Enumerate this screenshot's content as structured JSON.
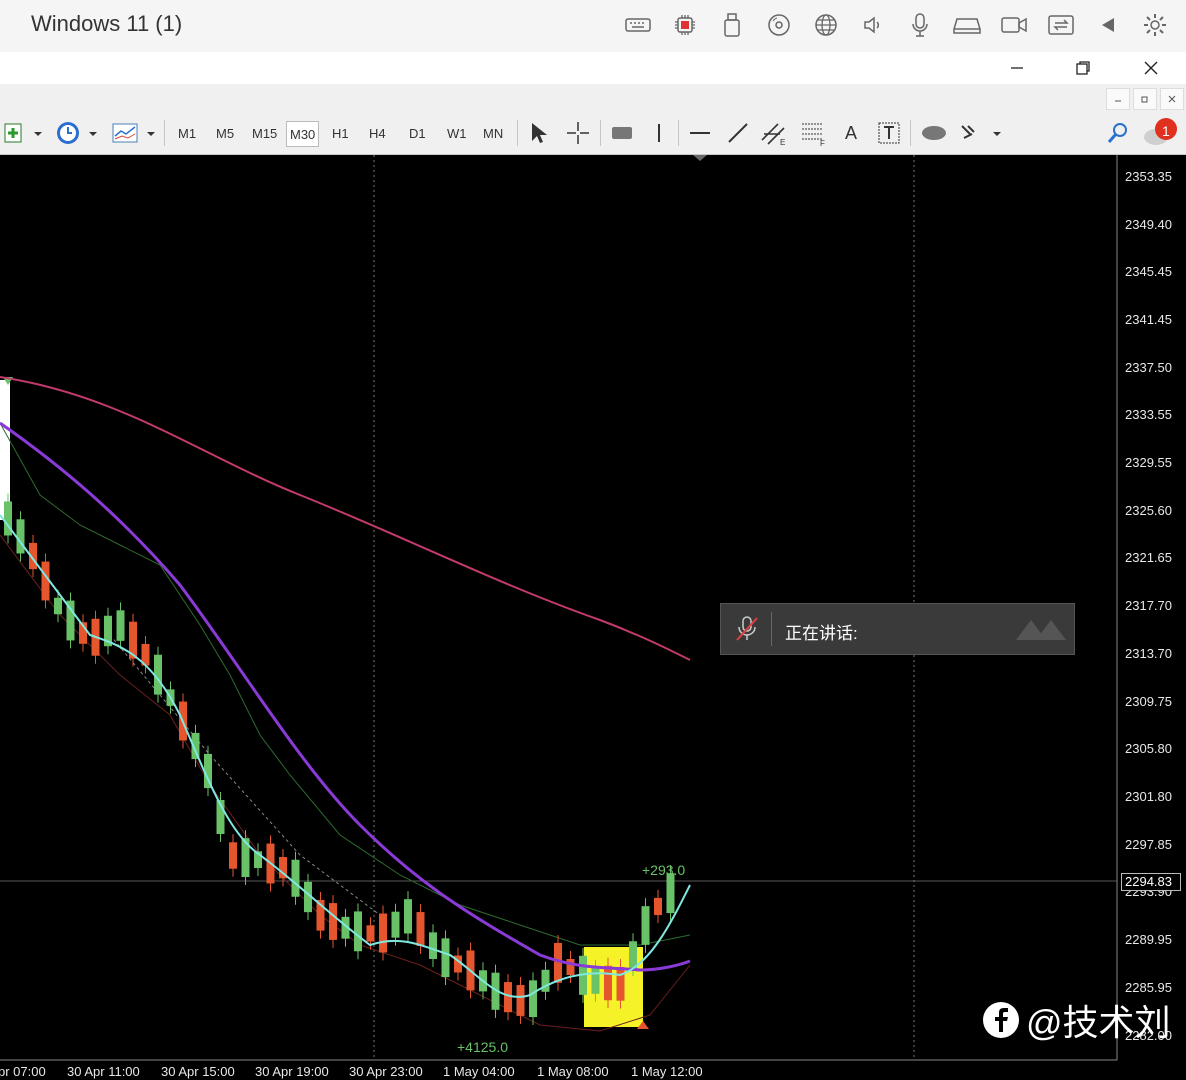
{
  "vm": {
    "title": "Windows 11 (1)",
    "icons": [
      "keyboard-icon",
      "cpu-icon",
      "usb-icon",
      "disc-icon",
      "network-icon",
      "speaker-icon",
      "microphone-icon",
      "drive-icon",
      "camera-icon",
      "share-icon",
      "back-icon",
      "gear-icon"
    ]
  },
  "toolbar": {
    "timeframes": [
      "M1",
      "M5",
      "M15",
      "M30",
      "H1",
      "H4",
      "D1",
      "W1",
      "MN"
    ],
    "selected_timeframe": "M30",
    "text_tool": "A",
    "notification_count": "1"
  },
  "chart": {
    "price_axis": [
      "2353.35",
      "2349.40",
      "2345.45",
      "2341.45",
      "2337.50",
      "2333.55",
      "2329.55",
      "2325.60",
      "2321.65",
      "2317.70",
      "2313.70",
      "2309.75",
      "2305.80",
      "2301.80",
      "2297.85",
      "2293.90",
      "2289.95",
      "2285.95",
      "2282.00"
    ],
    "time_axis": [
      "pr 07:00",
      "30 Apr 11:00",
      "30 Apr 15:00",
      "30 Apr 19:00",
      "30 Apr 23:00",
      "1 May 04:00",
      "1 May 08:00",
      "1 May 12:00"
    ],
    "current_price": "2294.83",
    "profit_label": "+293.0",
    "points_label": "+4125.0",
    "colors": {
      "bull": "#69c267",
      "bear": "#e5562f",
      "ma_fast": "#7fe8e0",
      "ma_mid": "#8a3ad6",
      "ma_slow": "#c23a6e",
      "highlight": "#f5f228"
    }
  },
  "overlay": {
    "speaking_label": "正在讲话:",
    "watermark": "@技术刘"
  }
}
